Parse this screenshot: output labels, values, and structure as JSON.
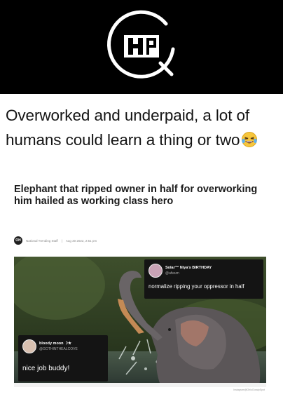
{
  "tweet": {
    "text": "Overworked and underpaid, a lot of humans could learn a thing or two",
    "emoji": "laughing-crying-emoji"
  },
  "article": {
    "headline": "Elephant that ripped owner in half for overworking him hailed as working class hero",
    "byline": {
      "avatar_text": "OH",
      "author": "National Trending Staff",
      "date": "Aug 30 2022, 2:51 pm"
    },
    "card_top": {
      "name": "Solar™ Niya's BIRTHDAY",
      "handle": "@afwum",
      "text": "normalize ripping your oppressor in half"
    },
    "card_bottom": {
      "name": "bloody moon ☽★",
      "handle": "@GOTHINTHEALCOVE",
      "text": "nice job buddy!"
    },
    "credit": "Instagram@OhioGossipSpot"
  },
  "colors": {
    "header_bg": "#000000",
    "panel_bg": "#ffffff",
    "card_bg": "#141414"
  }
}
